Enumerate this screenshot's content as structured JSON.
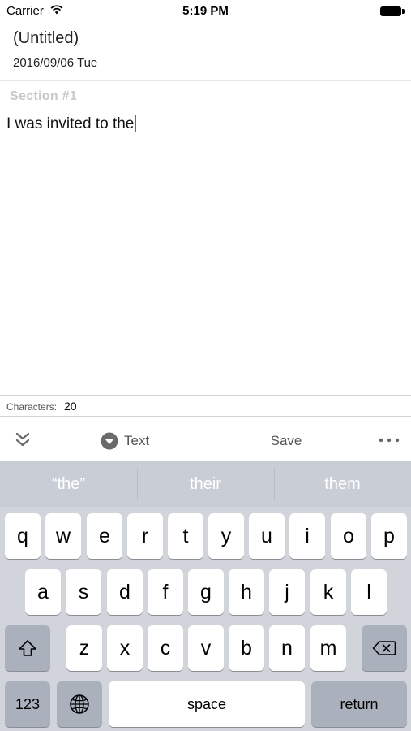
{
  "status_bar": {
    "carrier": "Carrier",
    "time": "5:19 PM"
  },
  "document": {
    "title": "(Untitled)",
    "date": "2016/09/06 Tue"
  },
  "editor": {
    "section_label": "Section  #1",
    "text": "I was invited to the"
  },
  "counter": {
    "label": "Characters:",
    "value": "20"
  },
  "toolbar": {
    "mode_label": "Text",
    "save_label": "Save"
  },
  "suggestions": [
    "“the”",
    "their",
    "them"
  ],
  "keyboard": {
    "row1": [
      "q",
      "w",
      "e",
      "r",
      "t",
      "y",
      "u",
      "i",
      "o",
      "p"
    ],
    "row2": [
      "a",
      "s",
      "d",
      "f",
      "g",
      "h",
      "j",
      "k",
      "l"
    ],
    "row3": [
      "z",
      "x",
      "c",
      "v",
      "b",
      "n",
      "m"
    ],
    "numbers_label": "123",
    "space_label": "space",
    "return_label": "return"
  },
  "colors": {
    "caret": "#3b6fd6",
    "keyboard_bg": "#d1d5db",
    "section_label": "#c8c8c8"
  },
  "icons": [
    "wifi-icon",
    "battery-icon",
    "collapse-keyboard-icon",
    "dropdown-circle-icon",
    "more-icon",
    "shift-icon",
    "backspace-icon",
    "globe-icon"
  ]
}
